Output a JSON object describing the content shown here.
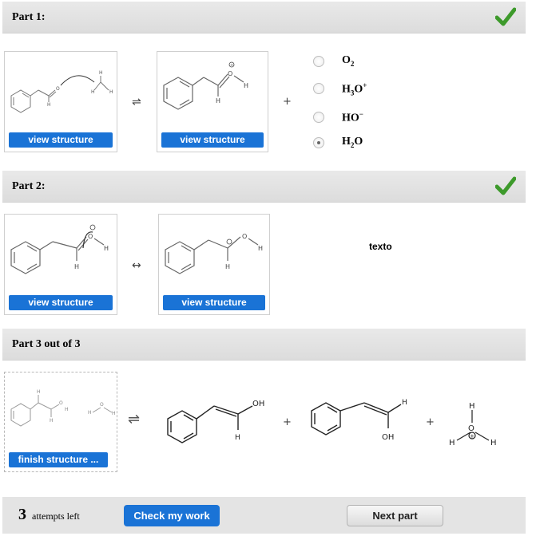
{
  "part1": {
    "title": "Part 1:",
    "status": "check-icon",
    "card1_button": "view structure",
    "card2_button": "view structure",
    "equilibrium_symbol": "⇌",
    "plus": "+",
    "options": [
      {
        "id": "o2",
        "main": "O",
        "sub": "2",
        "sup": "",
        "after": "",
        "selected": false
      },
      {
        "id": "h3o",
        "main": "H",
        "sub": "3",
        "sup": "+",
        "after": "O",
        "selected": false
      },
      {
        "id": "ho",
        "main": "HO",
        "sub": "",
        "sup": "−",
        "after": "",
        "selected": false
      },
      {
        "id": "h2o",
        "main": "H",
        "sub": "2",
        "sup": "",
        "after": "O",
        "selected": true
      }
    ]
  },
  "part2": {
    "title": "Part 2:",
    "status": "check-icon",
    "card1_button": "view structure",
    "card2_button": "view structure",
    "resonance_symbol": "↔",
    "note": "texto"
  },
  "part3": {
    "title": "Part 3 out of 3",
    "card_button": "finish structure ...",
    "equilibrium_symbol": "⇌",
    "plus1": "+",
    "plus2": "+",
    "product1_label": "OH",
    "product2_label": "OH",
    "h_label": "H"
  },
  "footer": {
    "attempts_count": "3",
    "attempts_label": "attempts left",
    "check_button": "Check my work",
    "next_button": "Next part"
  },
  "colors": {
    "accent_blue": "#1a73d6",
    "check_green": "#3d9a2b",
    "header_gray": "#e1e1e1"
  }
}
